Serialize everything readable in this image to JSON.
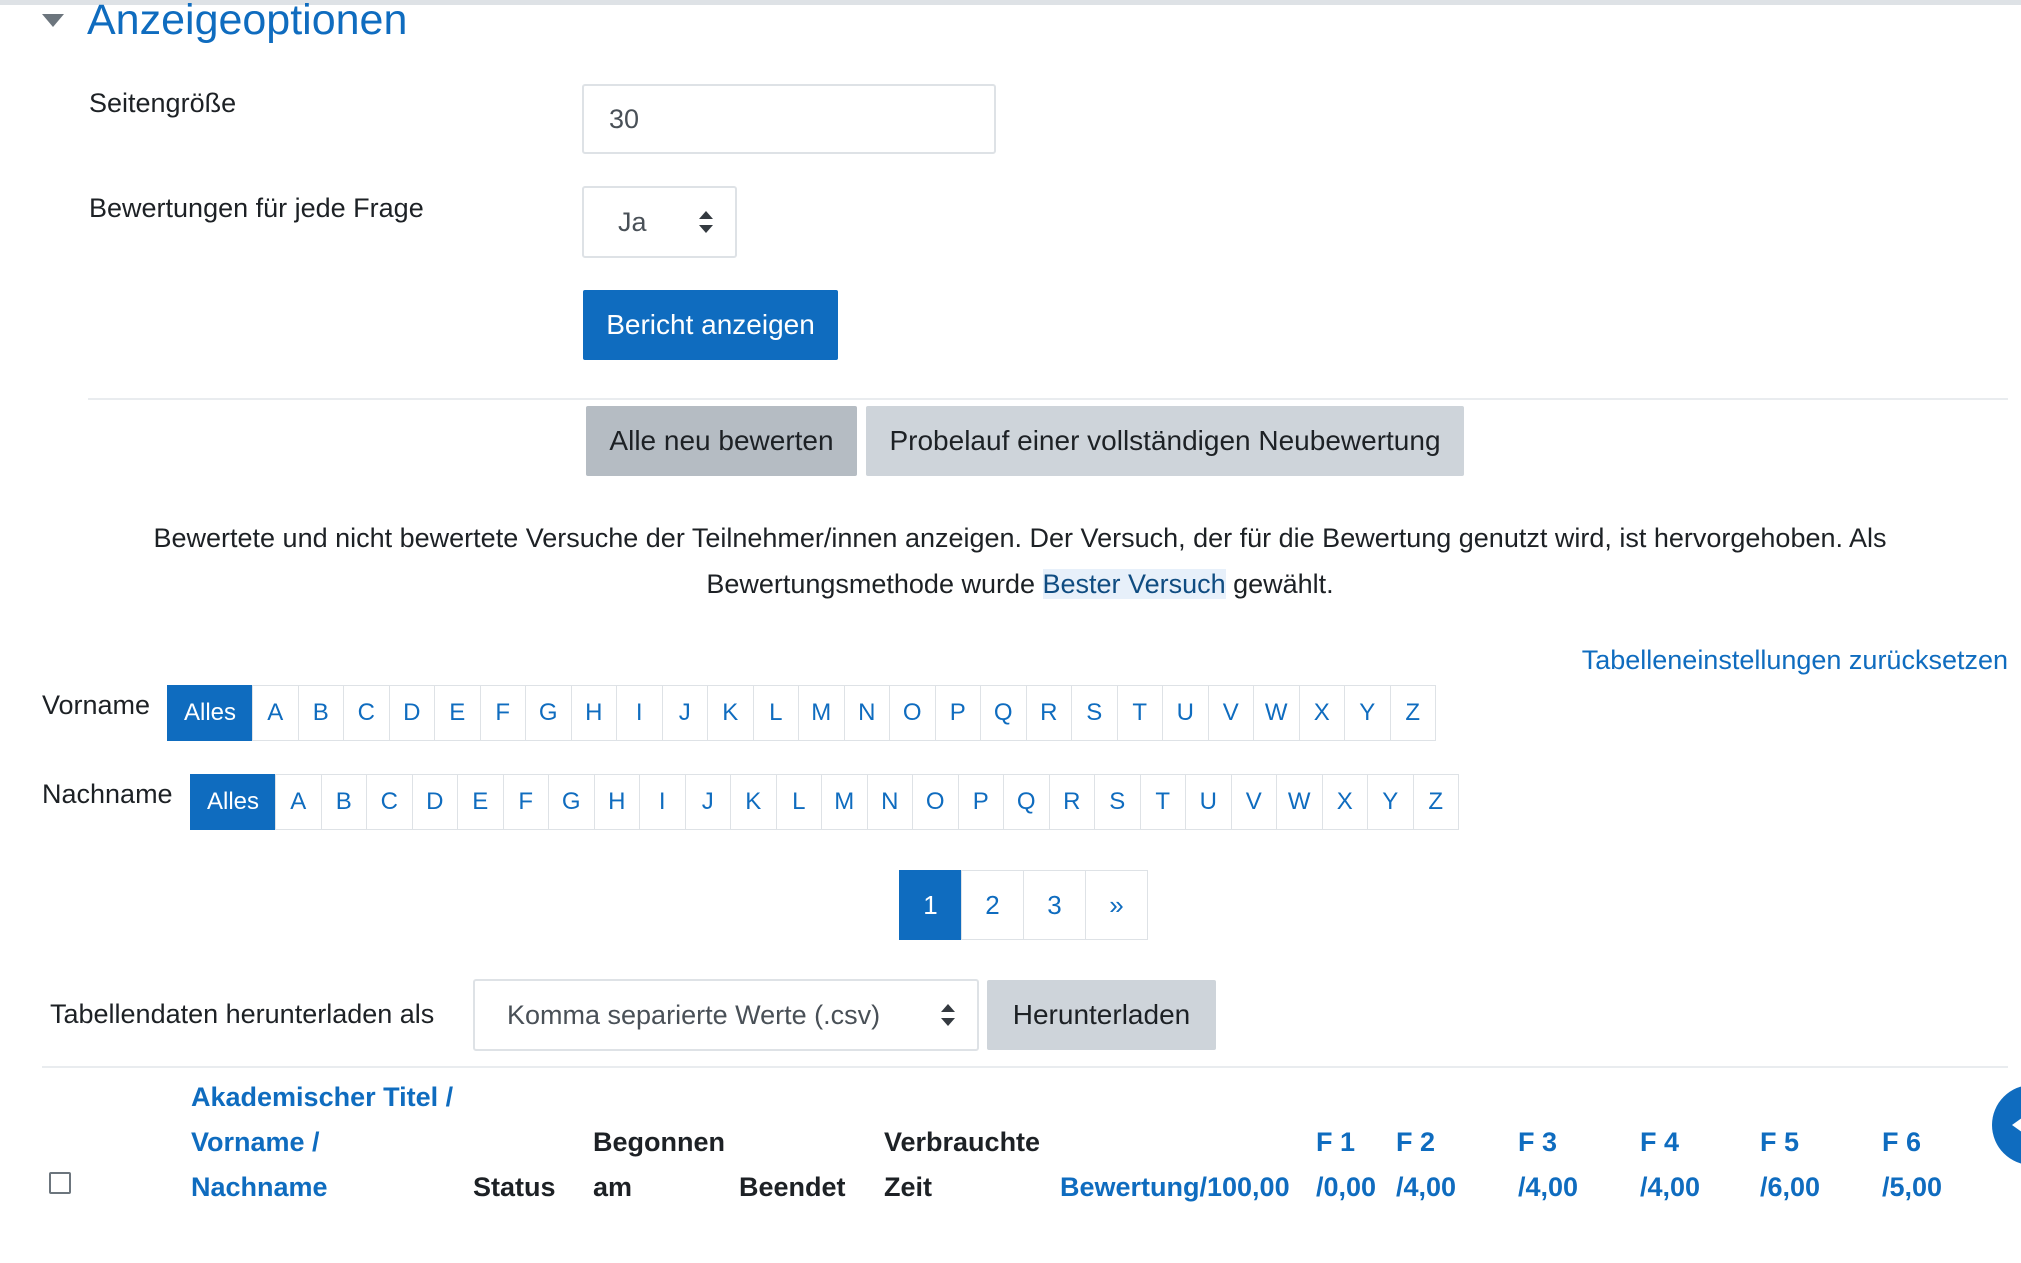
{
  "section": {
    "title": "Anzeigeoptionen"
  },
  "options": {
    "page_size_label": "Seitengröße",
    "page_size_value": "30",
    "per_question_label": "Bewertungen für jede Frage",
    "per_question_value": "Ja",
    "show_report_button": "Bericht anzeigen"
  },
  "regrade": {
    "regrade_all_button": "Alle neu bewerten",
    "dry_run_button": "Probelauf einer vollständigen Neubewertung"
  },
  "info": {
    "line1": "Bewertete und nicht bewertete Versuche der Teilnehmer/innen anzeigen. Der Versuch, der für die Bewertung genutzt wird, ist hervorgehoben. Als",
    "line2_prefix": "Bewertungsmethode wurde ",
    "line2_highlight": "Bester Versuch",
    "line2_suffix": " gewählt."
  },
  "reset_link": "Tabelleneinstellungen zurücksetzen",
  "initials": {
    "firstname_label": "Vorname",
    "lastname_label": "Nachname",
    "all_label": "Alles",
    "letters": [
      "A",
      "B",
      "C",
      "D",
      "E",
      "F",
      "G",
      "H",
      "I",
      "J",
      "K",
      "L",
      "M",
      "N",
      "O",
      "P",
      "Q",
      "R",
      "S",
      "T",
      "U",
      "V",
      "W",
      "X",
      "Y",
      "Z"
    ]
  },
  "pagination": {
    "pages": [
      "1",
      "2",
      "3"
    ],
    "next": "»",
    "current": "1"
  },
  "download": {
    "label": "Tabellendaten herunterladen als",
    "format_value": "Komma separierte Werte (.csv)",
    "button": "Herunterladen"
  },
  "table": {
    "col_name_line1": "Akademischer Titel /",
    "col_name_line2": "Vorname /",
    "col_name_line3": "Nachname",
    "col_status": "Status",
    "col_started_line1": "Begonnen",
    "col_started_line2": "am",
    "col_finished": "Beendet",
    "col_time_line1": "Verbrauchte",
    "col_time_line2": "Zeit",
    "col_grade": "Bewertung/100,00",
    "questions": [
      {
        "q": "F 1",
        "max": "/0,00"
      },
      {
        "q": "F 2",
        "max": "/4,00"
      },
      {
        "q": "F 3",
        "max": "/4,00"
      },
      {
        "q": "F 4",
        "max": "/4,00"
      },
      {
        "q": "F 5",
        "max": "/6,00"
      },
      {
        "q": "F 6",
        "max": "/5,00"
      }
    ]
  },
  "colors": {
    "accent": "#0f6cbf",
    "secondary_button": "#ced4da",
    "border": "#dee2e6"
  },
  "icons": [
    "collapse-caret-icon",
    "select-updown-icon",
    "back-arrow-icon"
  ]
}
